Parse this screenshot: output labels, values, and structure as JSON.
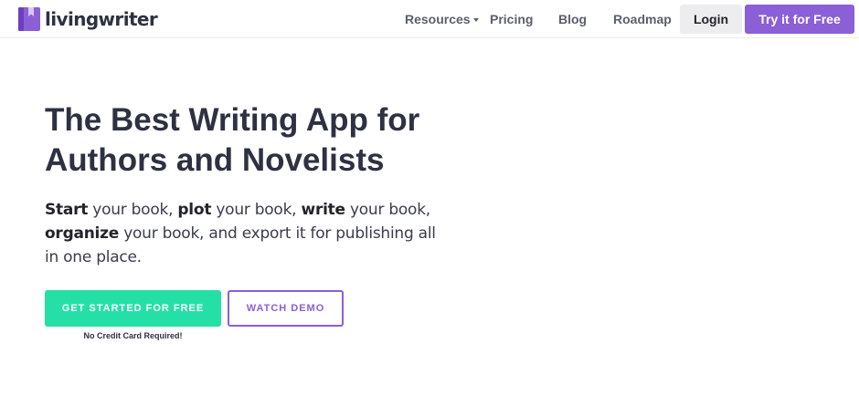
{
  "brand": {
    "name": "livingwriter",
    "accent_color": "#8b5fd6",
    "cta_color": "#25e0a6"
  },
  "nav": {
    "resources": "Resources",
    "pricing": "Pricing",
    "blog": "Blog",
    "roadmap": "Roadmap",
    "login": "Login",
    "try_free": "Try it for Free"
  },
  "hero": {
    "title_line1": "The Best Writing App for",
    "title_line2": "Authors and Novelists",
    "desc": {
      "start": "Start",
      "t1": " your book, ",
      "plot": "plot",
      "t2": " your book, ",
      "write": "write",
      "t3": " your book,",
      "organize": "organize",
      "t4": " your book, and export it for publishing all",
      "t5": "in one place."
    },
    "get_started": "GET STARTED FOR FREE",
    "watch_demo": "WATCH DEMO",
    "no_card": "No Credit Card Required!"
  }
}
